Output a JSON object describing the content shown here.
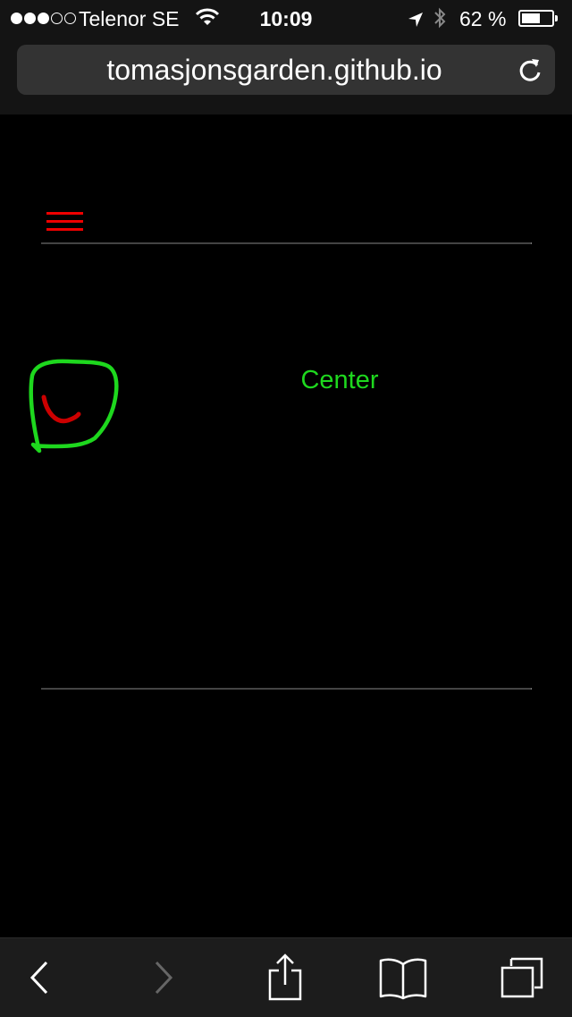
{
  "status_bar": {
    "carrier": "Telenor SE",
    "time": "10:09",
    "battery_percent": "62 %",
    "battery_level": 0.62,
    "signal_bars_filled": 3,
    "signal_bars_total": 5
  },
  "browser": {
    "url": "tomasjonsgarden.github.io",
    "icons": {
      "reload": "reload-icon",
      "back": "back-arrow-icon",
      "forward": "forward-arrow-icon",
      "share": "share-icon",
      "bookmarks": "bookmarks-icon",
      "tabs": "tabs-icon"
    }
  },
  "page": {
    "menu_icon": "hamburger-menu-icon",
    "center_label": "Center",
    "colors": {
      "menu": "#e00000",
      "label": "#1ed81e",
      "scribble_outline": "#1ed81e",
      "scribble_arc": "#cc0000"
    }
  }
}
